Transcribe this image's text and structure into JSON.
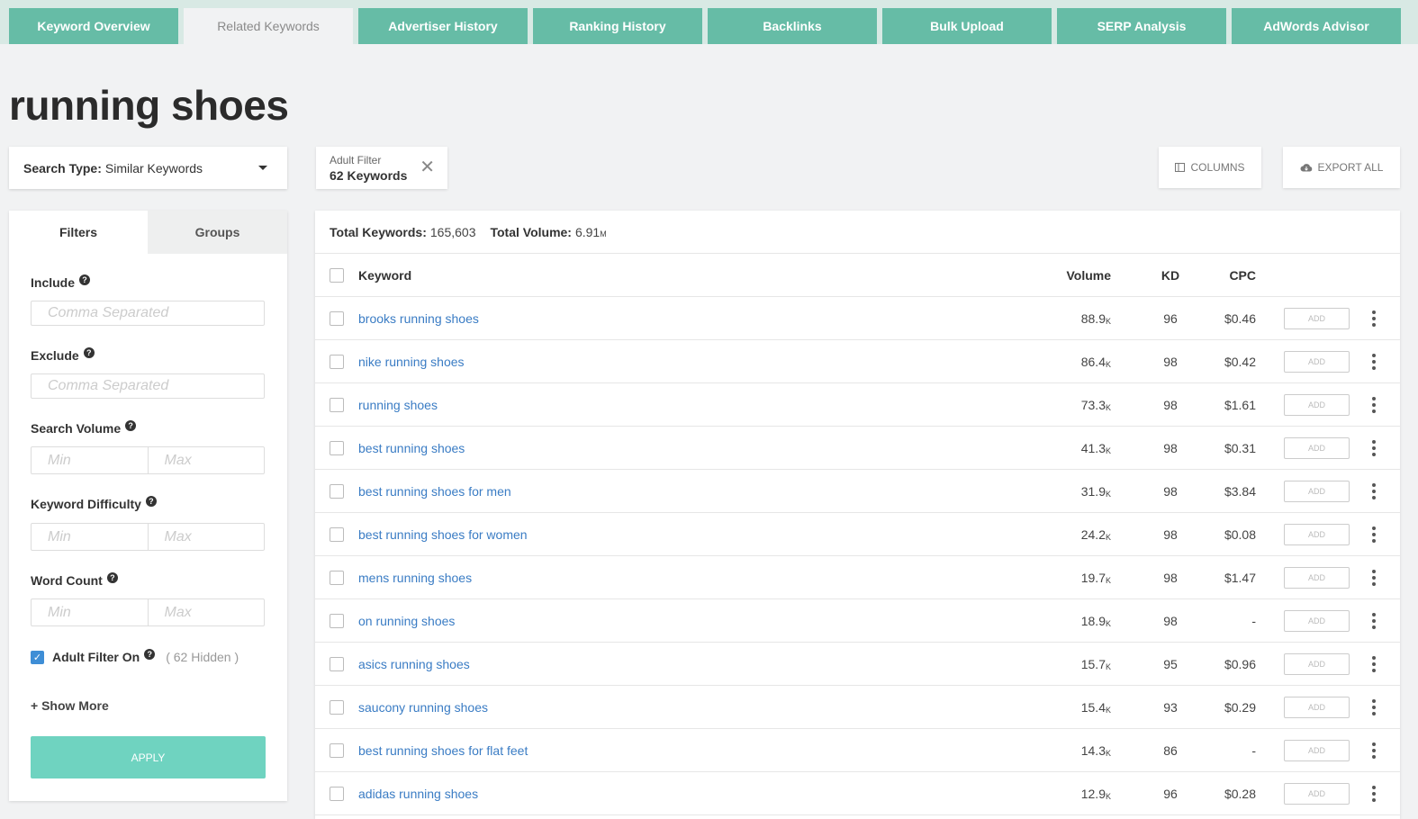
{
  "tabs": [
    {
      "label": "Keyword Overview",
      "active": false
    },
    {
      "label": "Related Keywords",
      "active": true
    },
    {
      "label": "Advertiser History",
      "active": false
    },
    {
      "label": "Ranking History",
      "active": false
    },
    {
      "label": "Backlinks",
      "active": false
    },
    {
      "label": "Bulk Upload",
      "active": false
    },
    {
      "label": "SERP Analysis",
      "active": false
    },
    {
      "label": "AdWords Advisor",
      "active": false
    }
  ],
  "page_title": "running shoes",
  "search_type": {
    "label": "Search Type:",
    "value": "Similar Keywords"
  },
  "filter_chip": {
    "label": "Adult Filter",
    "value": "62 Keywords"
  },
  "toolbar": {
    "columns_label": "COLUMNS",
    "export_label": "EXPORT ALL"
  },
  "panel": {
    "tab_filters": "Filters",
    "tab_groups": "Groups",
    "include_label": "Include",
    "include_placeholder": "Comma Separated",
    "exclude_label": "Exclude",
    "exclude_placeholder": "Comma Separated",
    "search_volume_label": "Search Volume",
    "keyword_difficulty_label": "Keyword Difficulty",
    "word_count_label": "Word Count",
    "min_placeholder": "Min",
    "max_placeholder": "Max",
    "adult_filter_label": "Adult Filter On",
    "adult_hidden": "( 62 Hidden )",
    "show_more": "+ Show More",
    "apply": "APPLY"
  },
  "totals": {
    "keywords_label": "Total Keywords:",
    "keywords_value": "165,603",
    "volume_label": "Total Volume:",
    "volume_value": "6.91",
    "volume_unit": "M"
  },
  "table": {
    "headers": {
      "keyword": "Keyword",
      "volume": "Volume",
      "kd": "KD",
      "cpc": "CPC"
    },
    "add_label": "ADD",
    "rows": [
      {
        "keyword": "brooks running shoes",
        "volume": "88.9",
        "unit": "K",
        "kd": "96",
        "cpc": "$0.46"
      },
      {
        "keyword": "nike running shoes",
        "volume": "86.4",
        "unit": "K",
        "kd": "98",
        "cpc": "$0.42"
      },
      {
        "keyword": "running shoes",
        "volume": "73.3",
        "unit": "K",
        "kd": "98",
        "cpc": "$1.61"
      },
      {
        "keyword": "best running shoes",
        "volume": "41.3",
        "unit": "K",
        "kd": "98",
        "cpc": "$0.31"
      },
      {
        "keyword": "best running shoes for men",
        "volume": "31.9",
        "unit": "K",
        "kd": "98",
        "cpc": "$3.84"
      },
      {
        "keyword": "best running shoes for women",
        "volume": "24.2",
        "unit": "K",
        "kd": "98",
        "cpc": "$0.08"
      },
      {
        "keyword": "mens running shoes",
        "volume": "19.7",
        "unit": "K",
        "kd": "98",
        "cpc": "$1.47"
      },
      {
        "keyword": "on running shoes",
        "volume": "18.9",
        "unit": "K",
        "kd": "98",
        "cpc": "-"
      },
      {
        "keyword": "asics running shoes",
        "volume": "15.7",
        "unit": "K",
        "kd": "95",
        "cpc": "$0.96"
      },
      {
        "keyword": "saucony running shoes",
        "volume": "15.4",
        "unit": "K",
        "kd": "93",
        "cpc": "$0.29"
      },
      {
        "keyword": "best running shoes for flat feet",
        "volume": "14.3",
        "unit": "K",
        "kd": "86",
        "cpc": "-"
      },
      {
        "keyword": "adidas running shoes",
        "volume": "12.9",
        "unit": "K",
        "kd": "96",
        "cpc": "$0.28"
      }
    ]
  }
}
